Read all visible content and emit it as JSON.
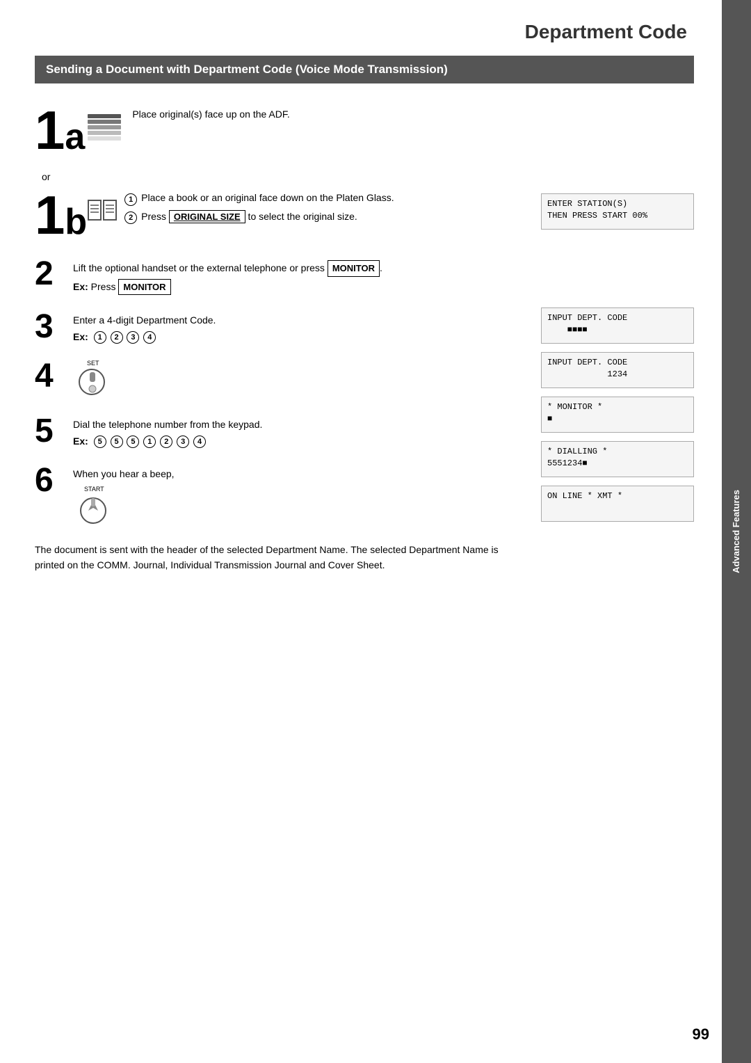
{
  "page": {
    "title": "Department Code",
    "page_number": "99",
    "sidebar_text": "Advanced Features"
  },
  "section": {
    "header": "Sending a Document with Department Code (Voice Mode Transmission)"
  },
  "steps": {
    "step1a": {
      "label": "1a",
      "description": "Place original(s) face up on the ADF."
    },
    "step1b": {
      "label": "1b",
      "sub_steps": [
        "Place a book or an original face down on the Platen Glass.",
        "Press  ORIGINAL SIZE  to select the original size."
      ]
    },
    "or_text": "or",
    "step2": {
      "number": "2",
      "text": "Lift the optional handset or the external telephone or press  MONITOR .",
      "ex_label": "Ex:",
      "ex_text": "Press  MONITOR"
    },
    "step3": {
      "number": "3",
      "text": "Enter a 4-digit Department Code.",
      "ex_label": "Ex:",
      "ex_circles": [
        "①",
        "②",
        "③",
        "④"
      ]
    },
    "step4": {
      "number": "4"
    },
    "step5": {
      "number": "5",
      "text": "Dial the telephone number from the keypad.",
      "ex_label": "Ex:",
      "ex_circles": [
        "⑤",
        "⑤",
        "⑤",
        "①",
        "②",
        "③",
        "④"
      ]
    },
    "step6": {
      "number": "6",
      "text": "When you hear a beep,"
    }
  },
  "lcd_screens": {
    "screen1": {
      "line1": "ENTER STATION(S)",
      "line2": "THEN PRESS START 00%"
    },
    "screen2": {
      "line1": "INPUT DEPT. CODE",
      "line2": "    ■■■■"
    },
    "screen3": {
      "line1": "INPUT DEPT. CODE",
      "line2": "            1234"
    },
    "screen4": {
      "line1": "* MONITOR *",
      "line2": "■"
    },
    "screen5": {
      "line1": "* DIALLING *",
      "line2": "5551234■"
    },
    "screen6": {
      "line1": "ON LINE * XMT *",
      "line2": ""
    }
  },
  "description": {
    "text": "The document is sent with the header of the selected Department Name.  The selected Department Name is printed on the COMM. Journal, Individual Transmission Journal and Cover Sheet."
  },
  "buttons": {
    "monitor": "MONITOR",
    "original_size": "ORIGINAL SIZE"
  }
}
